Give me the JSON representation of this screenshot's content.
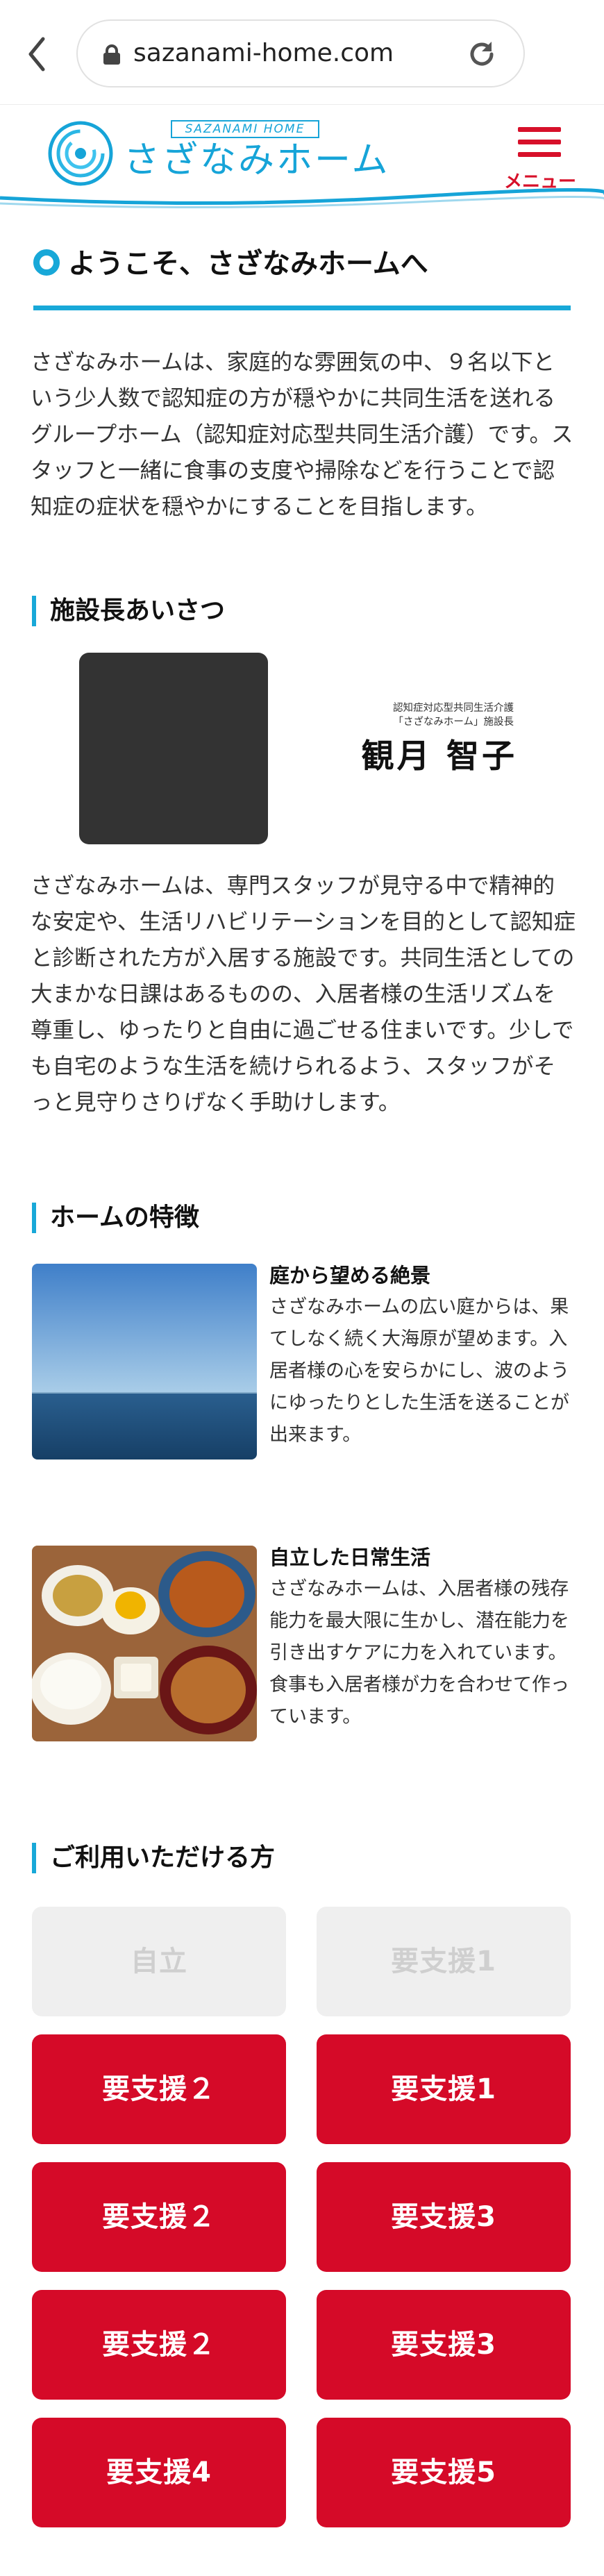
{
  "browser": {
    "url": "sazanami-home.com"
  },
  "header": {
    "logo_sub": "SAZANAMI HOME",
    "logo_title": "さざなみホーム",
    "menu_label": "メニュー"
  },
  "welcome": {
    "title": "ようこそ、さざなみホームへ",
    "body": "さざなみホームは、家庭的な雰囲気の中、９名以下という少人数で認知症の方が穏やかに共同生活を送れるグループホーム（認知症対応型共同生活介護）です。スタッフと一緒に食事の支度や掃除などを行うことで認知症の症状を穏やかにすることを目指します。"
  },
  "director": {
    "section_title": "施設長あいさつ",
    "role_line1": "認知症対応型共同生活介護",
    "role_line2": "「さざなみホーム」施設長",
    "name": "観月 智子",
    "message": "さざなみホームは、専門スタッフが見守る中で精神的な安定や、生活リハビリテーションを目的として認知症と診断された方が入居する施設です。共同生活としての大まかな日課はあるものの、入居者様の生活リズムを尊重し、ゆったりと自由に過ごせる住まいです。少しでも自宅のような生活を続けられるよう、スタッフがそっと見守りさりげなく手助けします。"
  },
  "features": {
    "section_title": "ホームの特徴",
    "items": [
      {
        "title": "庭から望める絶景",
        "text": "さざなみホームの広い庭からは、果てしなく続く大海原が望めます。入居者様の心を安らかにし、波のようにゆったりとした生活を送ることが出来ます。"
      },
      {
        "title": "自立した日常生活",
        "text": "さざなみホームは、入居者様の残存能力を最大限に生かし、潜在能力を引き出すケアに力を入れています。食事も入居者様が力を合わせて作っています。"
      }
    ]
  },
  "eligibility": {
    "section_title": "ご利用いただける方",
    "buttons": [
      {
        "label": "自立",
        "active": false
      },
      {
        "label": "要支援1",
        "active": false
      },
      {
        "label": "要支援２",
        "active": true
      },
      {
        "label": "要支援1",
        "active": true
      },
      {
        "label": "要支援２",
        "active": true
      },
      {
        "label": "要支援3",
        "active": true
      },
      {
        "label": "要支援２",
        "active": true
      },
      {
        "label": "要支援3",
        "active": true
      },
      {
        "label": "要支援4",
        "active": true
      },
      {
        "label": "要支援5",
        "active": true
      }
    ]
  },
  "colors": {
    "accent": "#18a8d8",
    "brand_red": "#d50a28",
    "disabled_bg": "#efefef"
  }
}
